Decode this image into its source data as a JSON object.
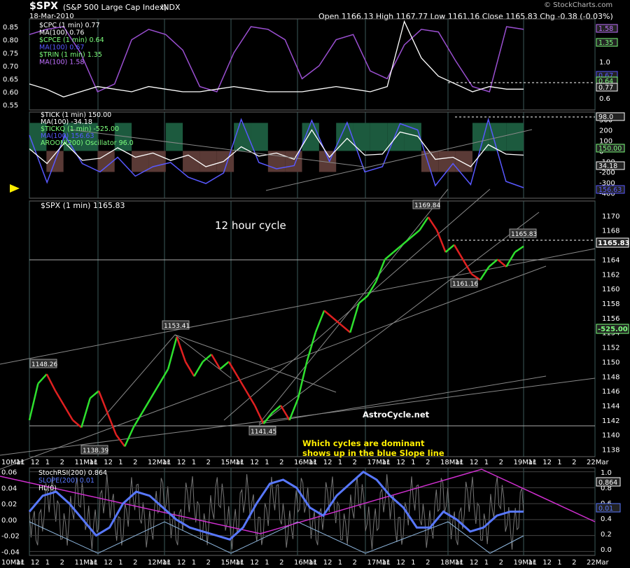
{
  "header": {
    "symbol": "$SPX",
    "name": "(S&P 500 Large Cap Index)",
    "exchange": "INDX",
    "date": "18-Mar-2010",
    "ohlc": "Open 1166.13  High 1167.77  Low 1161.16  Close 1165.83  Chg -0.38 (-0.03%)",
    "watermark": "© StockCharts.com"
  },
  "colors": {
    "accent_blue": "#5858ff",
    "purple": "#9a4fd0",
    "magenta": "#d02fd0",
    "green_fill": "#1c5a3e",
    "brown_fill": "#5a3a36",
    "arrow": "#ffee00"
  },
  "chart_data": [
    {
      "type": "line",
      "panel": "cpc",
      "y_ticks": [
        "0.85",
        "0.80",
        "0.75",
        "0.70",
        "0.65",
        "0.60",
        "0.55"
      ],
      "y_ticks_right": [
        "1.2",
        "1.0",
        "0.8",
        "0.6"
      ],
      "legend": [
        "$CPC (1 min) 0.77",
        "MA(100) 0.76",
        "$CPCE (1 min) 0.64",
        "MA(100) 0.67",
        "$TRIN (1 min) 1.35",
        "MA(100) 1.58"
      ],
      "right_labels": [
        "1.58",
        "1.35",
        "0.67",
        "0.64",
        "0.77"
      ],
      "series": [
        {
          "name": "MA(100) 0.76",
          "values": [
            0.63,
            0.61,
            0.58,
            0.6,
            0.62,
            0.61,
            0.6,
            0.62,
            0.61,
            0.6,
            0.6,
            0.61,
            0.62,
            0.61,
            0.6,
            0.6,
            0.6,
            0.61,
            0.62,
            0.61,
            0.6,
            0.62,
            0.87,
            0.73,
            0.66,
            0.63,
            0.6,
            0.62,
            0.61,
            0.61
          ]
        },
        {
          "name": "MA(100) 1.58",
          "values": [
            0.82,
            0.84,
            0.85,
            0.75,
            0.6,
            0.63,
            0.8,
            0.84,
            0.82,
            0.76,
            0.62,
            0.6,
            0.75,
            0.85,
            0.84,
            0.8,
            0.65,
            0.7,
            0.8,
            0.82,
            0.68,
            0.65,
            0.78,
            0.84,
            0.83,
            0.72,
            0.62,
            0.6,
            0.85,
            0.84
          ]
        }
      ]
    },
    {
      "type": "line",
      "panel": "tick",
      "y_ticks": [
        "300",
        "200",
        "100",
        "0",
        "-100",
        "-200",
        "-300",
        "-400"
      ],
      "legend": [
        "$TICK (1 min) 150.00",
        "MA(100) -34.18",
        "$TICKQ (1 min) -525.00",
        "MA(100) 156.63",
        "AROON(200) Oscillator 96.0"
      ],
      "right_labels": [
        "98.0",
        "150.00",
        "34.18",
        "156.63"
      ],
      "series": [
        {
          "name": "MA(100) -34.18",
          "values": [
            20,
            -120,
            80,
            -90,
            -70,
            30,
            -60,
            -20,
            -90,
            -40,
            -150,
            -100,
            40,
            -50,
            -20,
            -80,
            200,
            -60,
            120,
            -40,
            -30,
            180,
            140,
            -80,
            -60,
            -150,
            60,
            -30,
            -40
          ]
        },
        {
          "name": "MA(100) 156.63",
          "values": [
            150,
            -300,
            150,
            -120,
            -200,
            -60,
            -240,
            -150,
            -110,
            -250,
            -310,
            -210,
            300,
            -110,
            -170,
            -140,
            290,
            -100,
            270,
            -200,
            -150,
            260,
            200,
            -330,
            -120,
            -320,
            300,
            -290,
            -350
          ]
        }
      ]
    },
    {
      "type": "line",
      "panel": "price",
      "title": "$SPX (1 min) 1165.83",
      "annotation": "12 hour cycle",
      "watermark_text": "AstroCycle.net",
      "note_line1": "Which cycles are dominant",
      "note_line2": "shows up in the blue Slope line",
      "ylim": [
        1137,
        1172
      ],
      "y_ticks": [
        "1170",
        "1168",
        "1166",
        "1164",
        "1162",
        "1160",
        "1158",
        "1156",
        "1154",
        "1152",
        "1150",
        "1148",
        "1146",
        "1144",
        "1142",
        "1140",
        "1138"
      ],
      "right_labels": [
        "1165.83",
        "-525.00"
      ],
      "price_labels": [
        "1148.26",
        "1153.41",
        "1138.39",
        "1141.45",
        "1169.84",
        "1165.83",
        "1161.16"
      ],
      "series": [
        {
          "name": "$SPX",
          "values": [
            1142,
            1147,
            1148.3,
            1146,
            1144,
            1142,
            1141,
            1145,
            1146,
            1143,
            1140,
            1138.4,
            1141,
            1143,
            1145,
            1147,
            1149,
            1153.4,
            1150,
            1148,
            1150,
            1151,
            1149,
            1150,
            1148,
            1146,
            1144,
            1141.5,
            1143,
            1144,
            1142,
            1145,
            1150,
            1154,
            1157,
            1156,
            1155,
            1154,
            1158,
            1159,
            1161,
            1164,
            1165,
            1166,
            1167,
            1168,
            1169.8,
            1168,
            1165,
            1166,
            1164,
            1162,
            1161.2,
            1163,
            1164,
            1163,
            1165,
            1165.8
          ]
        }
      ]
    },
    {
      "type": "line",
      "panel": "stochrsi",
      "y_ticks": [
        "0.06",
        "0.04",
        "0.02",
        "0.00",
        "-0.02",
        "-0.04"
      ],
      "y_ticks_right": [
        "1.0",
        "0.8",
        "0.6",
        "0.4",
        "0.2",
        "0.0"
      ],
      "legend": [
        "StochRSI(200) 0.864",
        "SLOPE(200) 0.01",
        "HL(0)"
      ],
      "right_labels": [
        "0.864",
        "0.01"
      ],
      "series": [
        {
          "name": "SLOPE(200) 0.01",
          "values": [
            0.01,
            0.03,
            0.035,
            0.02,
            0.0,
            -0.02,
            -0.01,
            0.02,
            0.035,
            0.03,
            0.015,
            0.0,
            -0.01,
            -0.015,
            -0.02,
            -0.025,
            -0.01,
            0.02,
            0.045,
            0.05,
            0.04,
            0.015,
            0.005,
            0.03,
            0.045,
            0.06,
            0.05,
            0.03,
            0.015,
            -0.01,
            -0.01,
            0.01,
            0.0,
            -0.015,
            -0.01,
            0.005,
            0.01,
            0.01
          ]
        }
      ]
    }
  ],
  "x_axis": {
    "top_labels": [
      "10Mar",
      "11",
      "12",
      "1",
      "2",
      "11Mar",
      "11",
      "12",
      "1",
      "2",
      "12Mar",
      "11",
      "12",
      "1",
      "2",
      "15Mar",
      "11",
      "12",
      "1",
      "2",
      "16Mar",
      "11",
      "12",
      "1",
      "2",
      "17Mar",
      "11",
      "12",
      "1",
      "2",
      "18Mar",
      "11",
      "12",
      "1",
      "2",
      "19Mar",
      "11",
      "12",
      "1",
      "2",
      "22Mar"
    ],
    "bottom_labels": [
      "10Mar",
      "11",
      "12",
      "1",
      "2",
      "11Mar",
      "11",
      "12",
      "1",
      "2",
      "12Mar",
      "11",
      "12",
      "1",
      "2",
      "15Mar",
      "11",
      "12",
      "1",
      "2",
      "16Mar",
      "11",
      "12",
      "1",
      "2",
      "17Mar",
      "11",
      "12",
      "1",
      "2",
      "18Mar",
      "11",
      "12",
      "1",
      "2",
      "19Mar",
      "11",
      "12",
      "1",
      "2",
      "22Mar"
    ]
  }
}
